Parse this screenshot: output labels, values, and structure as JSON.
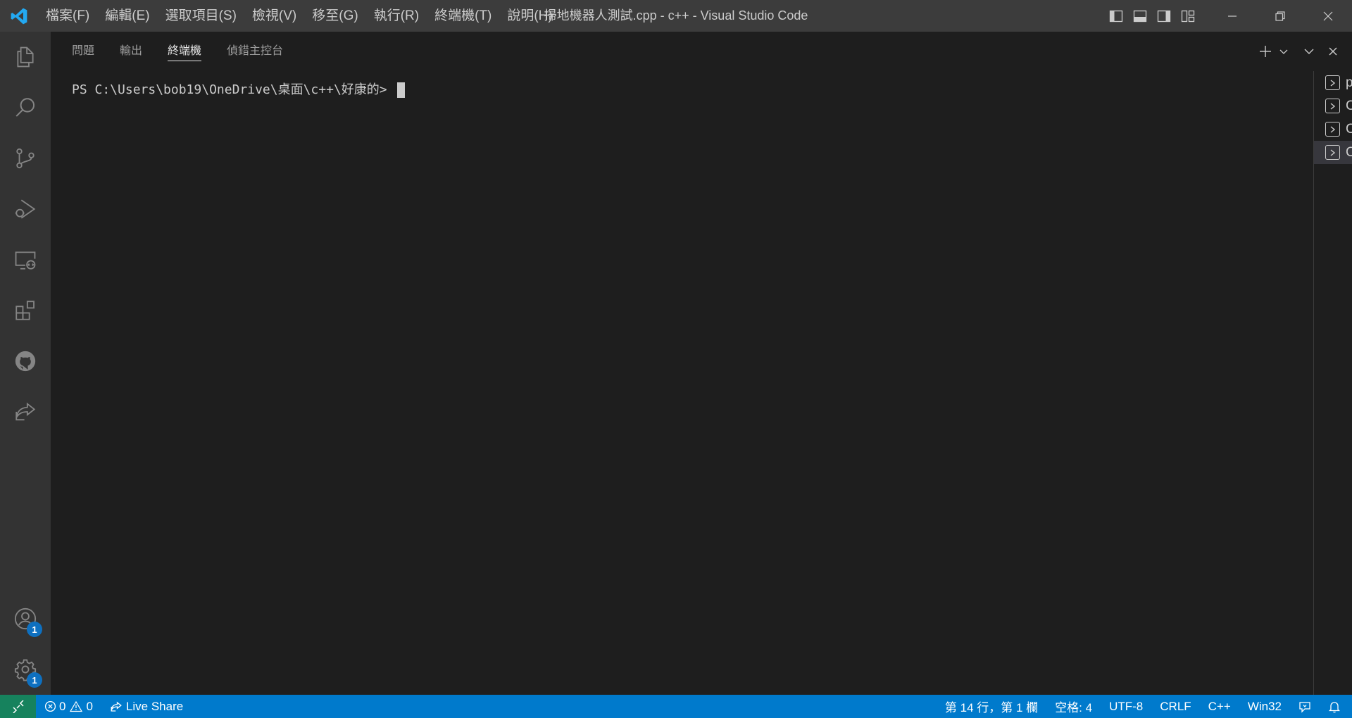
{
  "window": {
    "title": "掃地機器人測試.cpp - c++ - Visual Studio Code"
  },
  "menu": [
    {
      "label": "檔案(F)"
    },
    {
      "label": "編輯(E)"
    },
    {
      "label": "選取項目(S)"
    },
    {
      "label": "檢視(V)"
    },
    {
      "label": "移至(G)"
    },
    {
      "label": "執行(R)"
    },
    {
      "label": "終端機(T)"
    },
    {
      "label": "說明(H)"
    }
  ],
  "activity_bar": {
    "items": [
      {
        "icon": "explorer-icon"
      },
      {
        "icon": "search-icon"
      },
      {
        "icon": "source-control-icon"
      },
      {
        "icon": "run-debug-icon"
      },
      {
        "icon": "remote-explorer-icon"
      },
      {
        "icon": "extensions-icon"
      },
      {
        "icon": "github-icon"
      },
      {
        "icon": "live-share-icon"
      }
    ],
    "accounts_badge": "1",
    "settings_badge": "1"
  },
  "panel": {
    "tabs": [
      {
        "label": "問題",
        "active": false
      },
      {
        "label": "輸出",
        "active": false
      },
      {
        "label": "終端機",
        "active": true
      },
      {
        "label": "偵錯主控台",
        "active": false
      }
    ]
  },
  "terminal": {
    "prompt": "PS C:\\Users\\bob19\\OneDrive\\桌面\\c++\\好康的> "
  },
  "terminal_list": [
    {
      "label": "powe...",
      "selected": false
    },
    {
      "label": "Code",
      "selected": false
    },
    {
      "label": "Code",
      "selected": false
    },
    {
      "label": "Code",
      "selected": true
    }
  ],
  "status_bar": {
    "errors": "0",
    "warnings": "0",
    "live_share": "Live Share",
    "position": "第 14 行，第 1 欄",
    "spaces": "空格: 4",
    "encoding": "UTF-8",
    "eol": "CRLF",
    "language": "C++",
    "platform": "Win32"
  },
  "colors": {
    "titlebar": "#3c3c3c",
    "activitybar": "#333333",
    "editor_bg": "#1e1e1e",
    "statusbar": "#007acc",
    "remote": "#16825d",
    "vscode_blue": "#23a9f2"
  }
}
